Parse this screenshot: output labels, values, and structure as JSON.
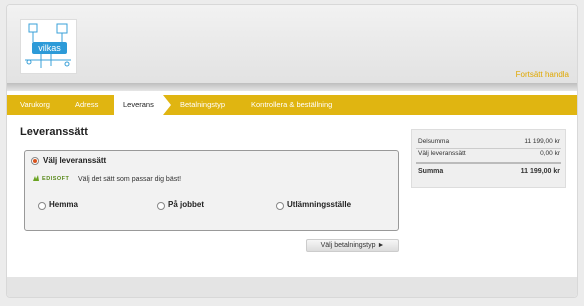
{
  "header": {
    "logo_text": "vilkas",
    "continue_link": "Fortsätt handla"
  },
  "tabs": [
    {
      "label": "Varukorg"
    },
    {
      "label": "Adress"
    },
    {
      "label": "Leverans"
    },
    {
      "label": "Betalningstyp"
    },
    {
      "label": "Kontrollera & beställning"
    }
  ],
  "main": {
    "title": "Leveranssätt",
    "box_title": "Välj leveranssätt",
    "provider_logo": "EDISOFT",
    "description": "Välj det sätt som passar dig bäst!",
    "options": [
      {
        "label": "Hemma"
      },
      {
        "label": "På jobbet"
      },
      {
        "label": "Utlämningsställe"
      }
    ],
    "next_button": "Välj betalningstyp ►"
  },
  "summary": {
    "rows": [
      {
        "label": "Delsumma",
        "value": "11 199,00 kr"
      },
      {
        "label": "Välj leveranssätt",
        "value": "0,00 kr"
      }
    ],
    "total_label": "Summa",
    "total_value": "11 199,00 kr"
  },
  "colors": {
    "accent": "#e0b511",
    "radio_selected": "#d9531e"
  }
}
